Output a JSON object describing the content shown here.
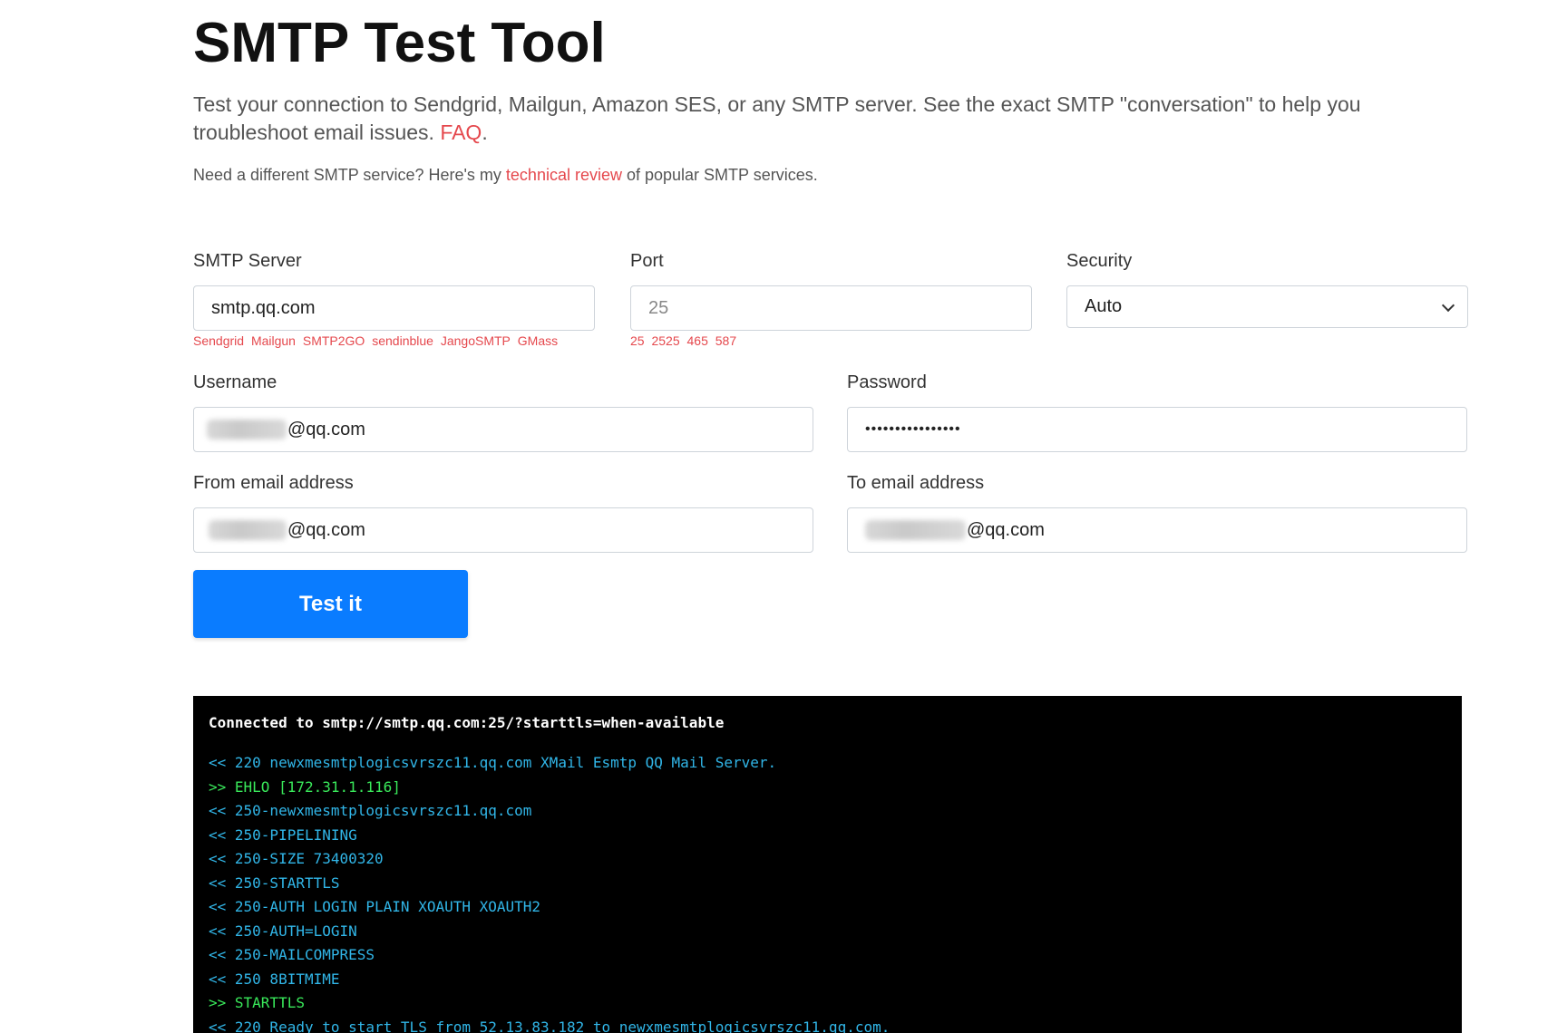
{
  "title": "SMTP Test Tool",
  "lead": {
    "text": "Test your connection to Sendgrid, Mailgun, Amazon SES, or any SMTP server. See the exact SMTP \"conversation\" to help you troubleshoot email issues. ",
    "faq_link": "FAQ",
    "end": "."
  },
  "sub": {
    "before": "Need a different SMTP service? Here's my ",
    "link": "technical review",
    "after": " of popular SMTP services."
  },
  "form": {
    "server": {
      "label": "SMTP Server",
      "value": "smtp.qq.com",
      "hints": [
        "Sendgrid",
        "Mailgun",
        "SMTP2GO",
        "sendinblue",
        "JangoSMTP",
        "GMass"
      ]
    },
    "port": {
      "label": "Port",
      "placeholder": "25",
      "hints": [
        "25",
        "2525",
        "465",
        "587"
      ]
    },
    "security": {
      "label": "Security",
      "selected": "Auto"
    },
    "username": {
      "label": "Username",
      "value_suffix": "@qq.com"
    },
    "password": {
      "label": "Password",
      "value_masked": "••••••••••••••••"
    },
    "from": {
      "label": "From email address",
      "value_suffix": "@qq.com"
    },
    "to": {
      "label": "To email address",
      "value_suffix": "@qq.com"
    },
    "submit_label": "Test it"
  },
  "terminal": {
    "header": "Connected to smtp://smtp.qq.com:25/?starttls=when-available",
    "lines": [
      {
        "dir": "in",
        "text": "<< 220 newxmesmtplogicsvrszc11.qq.com XMail Esmtp QQ Mail Server."
      },
      {
        "dir": "out",
        "text": ">> EHLO [172.31.1.116]"
      },
      {
        "dir": "in",
        "text": "<< 250-newxmesmtplogicsvrszc11.qq.com"
      },
      {
        "dir": "in",
        "text": "<< 250-PIPELINING"
      },
      {
        "dir": "in",
        "text": "<< 250-SIZE 73400320"
      },
      {
        "dir": "in",
        "text": "<< 250-STARTTLS"
      },
      {
        "dir": "in",
        "text": "<< 250-AUTH LOGIN PLAIN XOAUTH XOAUTH2"
      },
      {
        "dir": "in",
        "text": "<< 250-AUTH=LOGIN"
      },
      {
        "dir": "in",
        "text": "<< 250-MAILCOMPRESS"
      },
      {
        "dir": "in",
        "text": "<< 250 8BITMIME"
      },
      {
        "dir": "out",
        "text": ">> STARTTLS"
      },
      {
        "dir": "in",
        "text": "<< 220 Ready to start TLS from 52.13.83.182 to newxmesmtplogicsvrszc11.qq.com."
      }
    ]
  }
}
